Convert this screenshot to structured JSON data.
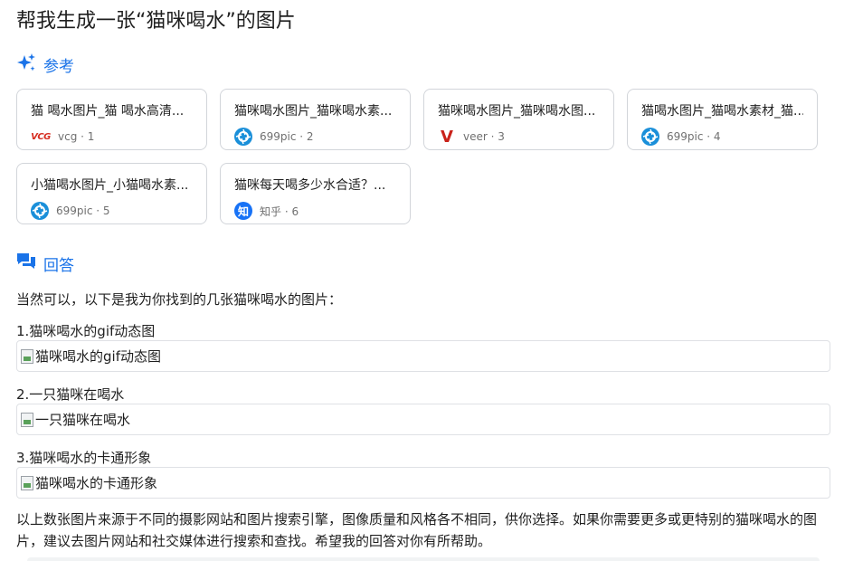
{
  "question": "帮我生成一张“猫咪喝水”的图片",
  "references": {
    "label": "参考",
    "cards": [
      {
        "title": "猫 喝水图片_猫 喝水高清...",
        "source": "vcg · 1",
        "icon": "vcg-logo",
        "icon_text": "VCG"
      },
      {
        "title": "猫咪喝水图片_猫咪喝水素...",
        "source": "699pic · 2",
        "icon": "699pic-logo"
      },
      {
        "title": "猫咪喝水图片_猫咪喝水图...",
        "source": "veer · 3",
        "icon": "veer-logo",
        "icon_text": "V"
      },
      {
        "title": "猫喝水图片_猫喝水素材_猫...",
        "source": "699pic · 4",
        "icon": "699pic-logo"
      },
      {
        "title": "小猫喝水图片_小猫喝水素...",
        "source": "699pic · 5",
        "icon": "699pic-logo"
      },
      {
        "title": "猫咪每天喝多少水合适？...",
        "source": "知乎 · 6",
        "icon": "zhihu-logo",
        "icon_text": "知"
      }
    ]
  },
  "answer": {
    "label": "回答",
    "intro": "当然可以，以下是我为你找到的几张猫咪喝水的图片：",
    "items": [
      {
        "heading": "1.猫咪喝水的gif动态图",
        "alt": "猫咪喝水的gif动态图"
      },
      {
        "heading": "2.一只猫咪在喝水",
        "alt": "一只猫咪在喝水"
      },
      {
        "heading": "3.猫咪喝水的卡通形象",
        "alt": "猫咪喝水的卡通形象"
      }
    ],
    "closing": "以上数张图片来源于不同的摄影网站和图片搜索引擎，图像质量和风格各不相同，供你选择。如果你需要更多或更特别的猫咪喝水的图片，建议去图片网站和社交媒体进行搜索和查找。希望我的回答对你有所帮助。"
  },
  "colors": {
    "accent": "#1a73e8"
  }
}
